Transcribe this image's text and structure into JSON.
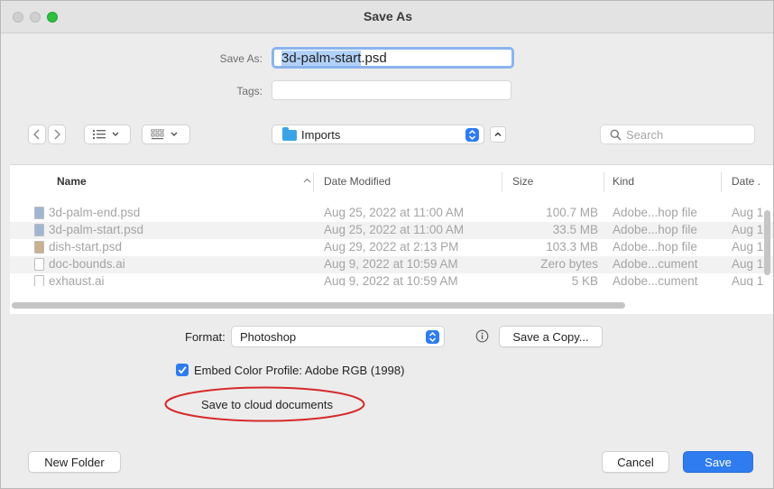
{
  "window": {
    "title": "Save As"
  },
  "form": {
    "save_as_label": "Save As:",
    "save_as_selected": "3d-palm-start",
    "save_as_ext": ".psd",
    "tags_label": "Tags:",
    "tags_value": ""
  },
  "toolbar": {
    "location": "Imports",
    "search_placeholder": "Search"
  },
  "columns": [
    "Name",
    "Date Modified",
    "Size",
    "Kind",
    "Date ."
  ],
  "files": [
    {
      "name": "3d-palm-end.psd",
      "date": "Aug 25, 2022 at 11:00 AM",
      "size": "100.7 MB",
      "kind": "Adobe...hop file",
      "date_added": "Aug 1",
      "icon": "psd-file-icon"
    },
    {
      "name": "3d-palm-start.psd",
      "date": "Aug 25, 2022 at 11:00 AM",
      "size": "33.5 MB",
      "kind": "Adobe...hop file",
      "date_added": "Aug 1",
      "icon": "psd-file-icon"
    },
    {
      "name": "dish-start.psd",
      "date": "Aug 29, 2022 at 2:13 PM",
      "size": "103.3 MB",
      "kind": "Adobe...hop file",
      "date_added": "Aug 1",
      "icon": "psd-file-icon"
    },
    {
      "name": "doc-bounds.ai",
      "date": "Aug 9, 2022 at 10:59 AM",
      "size": "Zero bytes",
      "kind": "Adobe...cument",
      "date_added": "Aug 1",
      "icon": "ai-file-icon"
    },
    {
      "name": "exhaust.ai",
      "date": "Aug 9, 2022 at 10:59 AM",
      "size": "5 KB",
      "kind": "Adobe...cument",
      "date_added": "Aug 1",
      "icon": "ai-file-icon"
    }
  ],
  "options": {
    "format_label": "Format:",
    "format_value": "Photoshop",
    "save_copy": "Save a Copy...",
    "embed_label": "Embed Color Profile:",
    "embed_value": "Adobe RGB (1998)",
    "embed_checked": true,
    "cloud": "Save to cloud documents"
  },
  "buttons": {
    "new_folder": "New Folder",
    "cancel": "Cancel",
    "save": "Save"
  },
  "colors": {
    "accent": "#2f7cf0",
    "highlight_ring": "#d62a2a"
  }
}
